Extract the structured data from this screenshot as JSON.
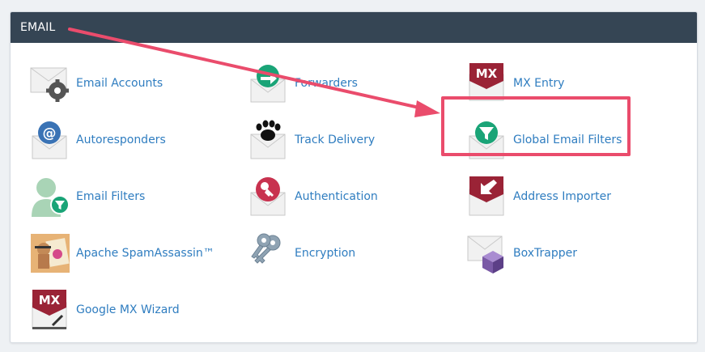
{
  "section": {
    "title": "EMAIL"
  },
  "items": [
    {
      "label": "Email Accounts"
    },
    {
      "label": "Forwarders"
    },
    {
      "label": "MX Entry"
    },
    {
      "label": "Autoresponders"
    },
    {
      "label": "Track Delivery"
    },
    {
      "label": "Global Email Filters"
    },
    {
      "label": "Email Filters"
    },
    {
      "label": "Authentication"
    },
    {
      "label": "Address Importer"
    },
    {
      "label": "Apache SpamAssassin™"
    },
    {
      "label": "Encryption"
    },
    {
      "label": "BoxTrapper"
    },
    {
      "label": "Google MX Wizard"
    }
  ],
  "icons": {
    "mx_text": "MX",
    "at_symbol": "@"
  },
  "colors": {
    "header_bg": "#354554",
    "link": "#2f7dc0",
    "highlight": "#ea4c6c",
    "green": "#1aa477",
    "maroon": "#9a2336",
    "blue": "#3a73b5"
  }
}
